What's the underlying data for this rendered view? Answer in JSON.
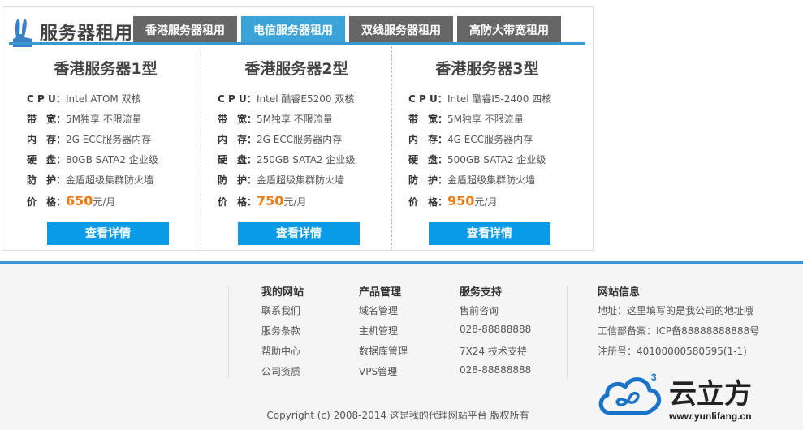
{
  "header": {
    "title": "服务器租用",
    "tabs": [
      {
        "label": "香港服务器租用",
        "active": false
      },
      {
        "label": "电信服务器租用",
        "active": true
      },
      {
        "label": "双线服务器租用",
        "active": false
      },
      {
        "label": "高防大带宽租用",
        "active": false
      }
    ]
  },
  "servers": [
    {
      "title": "香港服务器1型",
      "specs": [
        {
          "label": "C P U：",
          "value": "Intel ATOM 双核"
        },
        {
          "label": "带　宽：",
          "value": "5M独享 不限流量"
        },
        {
          "label": "内　存：",
          "value": "2G ECC服务器内存"
        },
        {
          "label": "硬　盘：",
          "value": "80GB SATA2 企业级"
        },
        {
          "label": "防　护：",
          "value": "金盾超级集群防火墙"
        }
      ],
      "price_label": "价　格：",
      "price": "650",
      "price_unit": "元/月",
      "button": "查看详情"
    },
    {
      "title": "香港服务器2型",
      "specs": [
        {
          "label": "C P U：",
          "value": "Intel 酷睿E5200 双核"
        },
        {
          "label": "带　宽：",
          "value": "5M独享 不限流量"
        },
        {
          "label": "内　存：",
          "value": "2G ECC服务器内存"
        },
        {
          "label": "硬　盘：",
          "value": "250GB SATA2 企业级"
        },
        {
          "label": "防　护：",
          "value": "金盾超级集群防火墙"
        }
      ],
      "price_label": "价　格：",
      "price": "750",
      "price_unit": "元/月",
      "button": "查看详情"
    },
    {
      "title": "香港服务器3型",
      "specs": [
        {
          "label": "C P U：",
          "value": "Intel 酷睿I5-2400 四核"
        },
        {
          "label": "带　宽：",
          "value": "5M独享 不限流量"
        },
        {
          "label": "内　存：",
          "value": "4G ECC服务器内存"
        },
        {
          "label": "硬　盘：",
          "value": "500GB SATA2 企业级"
        },
        {
          "label": "防　护：",
          "value": "金盾超级集群防火墙"
        }
      ],
      "price_label": "价　格：",
      "price": "950",
      "price_unit": "元/月",
      "button": "查看详情"
    }
  ],
  "footer": {
    "columns": [
      {
        "title": "我的网站",
        "links": [
          "联系我们",
          "服务条款",
          "帮助中心",
          "公司资质"
        ]
      },
      {
        "title": "产品管理",
        "links": [
          "域名管理",
          "主机管理",
          "数据库管理",
          "VPS管理"
        ]
      },
      {
        "title": "服务支持",
        "links": [
          "售前咨询",
          "028-88888888",
          "7X24 技术支持",
          "028-88888888"
        ]
      }
    ],
    "info": {
      "title": "网站信息",
      "lines": [
        "地址：这里填写的是我公司的地址哦",
        "工信部备案：ICP备88888888888号",
        "注册号：40100000580595(1-1)"
      ]
    },
    "copyright": "Copyright (c) 2008-2014 这是我的代理网站平台 版权所有"
  },
  "logo": {
    "name": "云立方",
    "superscript": "3",
    "url_text": "www.yunlifang.cn",
    "colors": {
      "blue": "#1a73c9",
      "text": "#222"
    }
  }
}
